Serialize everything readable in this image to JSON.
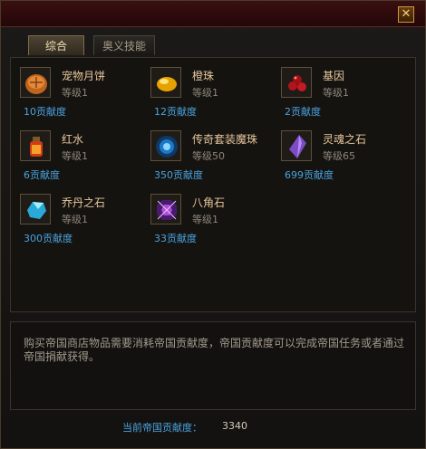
{
  "tabs": [
    {
      "label": "综合",
      "active": true
    },
    {
      "label": "奥义技能",
      "active": false
    }
  ],
  "close_icon": "close-x-icon",
  "items": [
    {
      "name": "宠物月饼",
      "level": "等级1",
      "cost": "10贡献度",
      "icon": "mooncake-icon"
    },
    {
      "name": "橙珠",
      "level": "等级1",
      "cost": "12贡献度",
      "icon": "orange-pearl-icon"
    },
    {
      "name": "基因",
      "level": "等级1",
      "cost": "2贡献度",
      "icon": "gene-berries-icon"
    },
    {
      "name": "红水",
      "level": "等级1",
      "cost": "6贡献度",
      "icon": "red-potion-icon"
    },
    {
      "name": "传奇套装魔珠",
      "level": "等级50",
      "cost": "350贡献度",
      "icon": "blue-orb-icon"
    },
    {
      "name": "灵魂之石",
      "level": "等级65",
      "cost": "699贡献度",
      "icon": "soul-stone-icon"
    },
    {
      "name": "乔丹之石",
      "level": "等级1",
      "cost": "300贡献度",
      "icon": "jordan-stone-icon"
    },
    {
      "name": "八角石",
      "level": "等级1",
      "cost": "33贡献度",
      "icon": "octagon-stone-icon"
    }
  ],
  "description": "购买帝国商店物品需要消耗帝国贡献度，帝国贡献度可以完成帝国任务或者通过帝国捐献获得。",
  "status": {
    "label": "当前帝国贡献度：",
    "value": "3340"
  },
  "colors": {
    "cost": "#49a3e0",
    "name": "#e7c79c",
    "titlebar": "#3a0f10"
  }
}
